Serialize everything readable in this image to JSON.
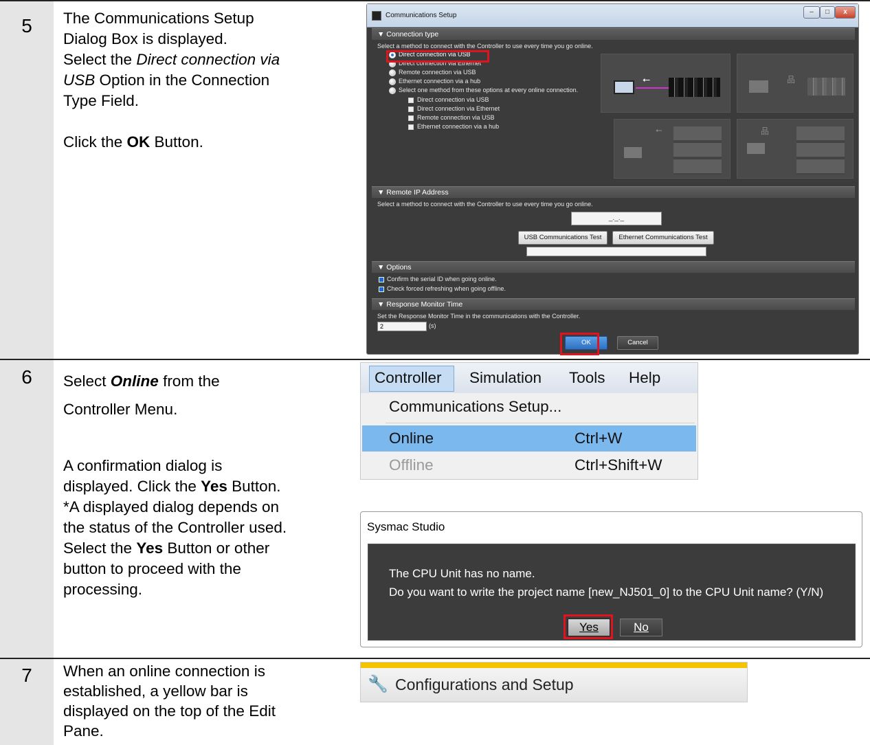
{
  "steps": [
    {
      "number": "5",
      "lines": [
        [
          "The Communications Setup"
        ],
        [
          "Dialog Box is displayed."
        ],
        [
          "Select the ",
          {
            "i": "Direct connection via"
          }
        ],
        [
          {
            "i": "USB"
          },
          " Option in the Connection"
        ],
        [
          "Type Field."
        ],
        [
          ""
        ],
        [
          "Click the ",
          {
            "b": "OK"
          },
          " Button."
        ]
      ]
    },
    {
      "number": "6",
      "lines_a": [
        [
          "Select ",
          {
            "bi": "Online"
          },
          " from the"
        ],
        [
          "Controller Menu."
        ]
      ],
      "lines_b": [
        [
          "A confirmation dialog is"
        ],
        [
          "displayed. Click the ",
          {
            "b": "Yes"
          },
          " Button."
        ],
        [
          "*A displayed dialog depends on"
        ],
        [
          "the status of the Controller used."
        ],
        [
          "Select the ",
          {
            "b": "Yes"
          },
          " Button or other"
        ],
        [
          "button to proceed with the"
        ],
        [
          "processing."
        ]
      ]
    },
    {
      "number": "7",
      "lines": [
        [
          "When an online connection is"
        ],
        [
          "established, a yellow bar is"
        ],
        [
          "displayed on the top of the Edit"
        ],
        [
          "Pane."
        ]
      ]
    }
  ],
  "comm_dialog": {
    "title": "Communications Setup",
    "sections": {
      "connection_type": "▼ Connection type",
      "remote_ip": "▼ Remote IP Address",
      "options": "▼ Options",
      "response": "▼ Response Monitor Time"
    },
    "conn_prompt": "Select a method to connect with the Controller to use every time you go online.",
    "radios": [
      "Direct connection via USB",
      "Direct connection via Ethernet",
      "Remote connection via USB",
      "Ethernet connection via a hub",
      "Select one method from these options at every online connection."
    ],
    "sub_checks": [
      "Direct connection via USB",
      "Direct connection via Ethernet",
      "Remote connection via USB",
      "Ethernet connection via a hub"
    ],
    "ip_prompt": "Select a method to connect with the Controller to use every time you go online.",
    "ip_value": "_._._",
    "usb_test": "USB Communications Test",
    "eth_test": "Ethernet Communications Test",
    "opt1": "Confirm the serial ID when going online.",
    "opt2": "Check forced refreshing when going offline.",
    "resp_prompt": "Set the Response Monitor Time in the communications with the Controller.",
    "resp_value": "2",
    "resp_unit": "(s)",
    "ok": "OK",
    "cancel": "Cancel",
    "win_min": "‒",
    "win_max": "□",
    "win_close": "x"
  },
  "menu": {
    "bar": [
      "Controller",
      "Simulation",
      "Tools",
      "Help"
    ],
    "items": [
      {
        "label": "Communications Setup...",
        "shortcut": ""
      },
      {
        "label": "Online",
        "shortcut": "Ctrl+W"
      },
      {
        "label": "Offline",
        "shortcut": "Ctrl+Shift+W"
      }
    ]
  },
  "confirm_dialog": {
    "title": "Sysmac Studio",
    "line1": "The CPU Unit has no name.",
    "line2": "Do you want to write the project name [new_NJ501_0] to the CPU Unit name? (Y/N)",
    "yes": "Yes",
    "no": "No"
  },
  "edit_pane": {
    "label": "Configurations and Setup"
  },
  "colors": {
    "highlight_red": "#e0141e",
    "menu_selected": "#7ab8ee",
    "online_bar": "#f5c400"
  }
}
